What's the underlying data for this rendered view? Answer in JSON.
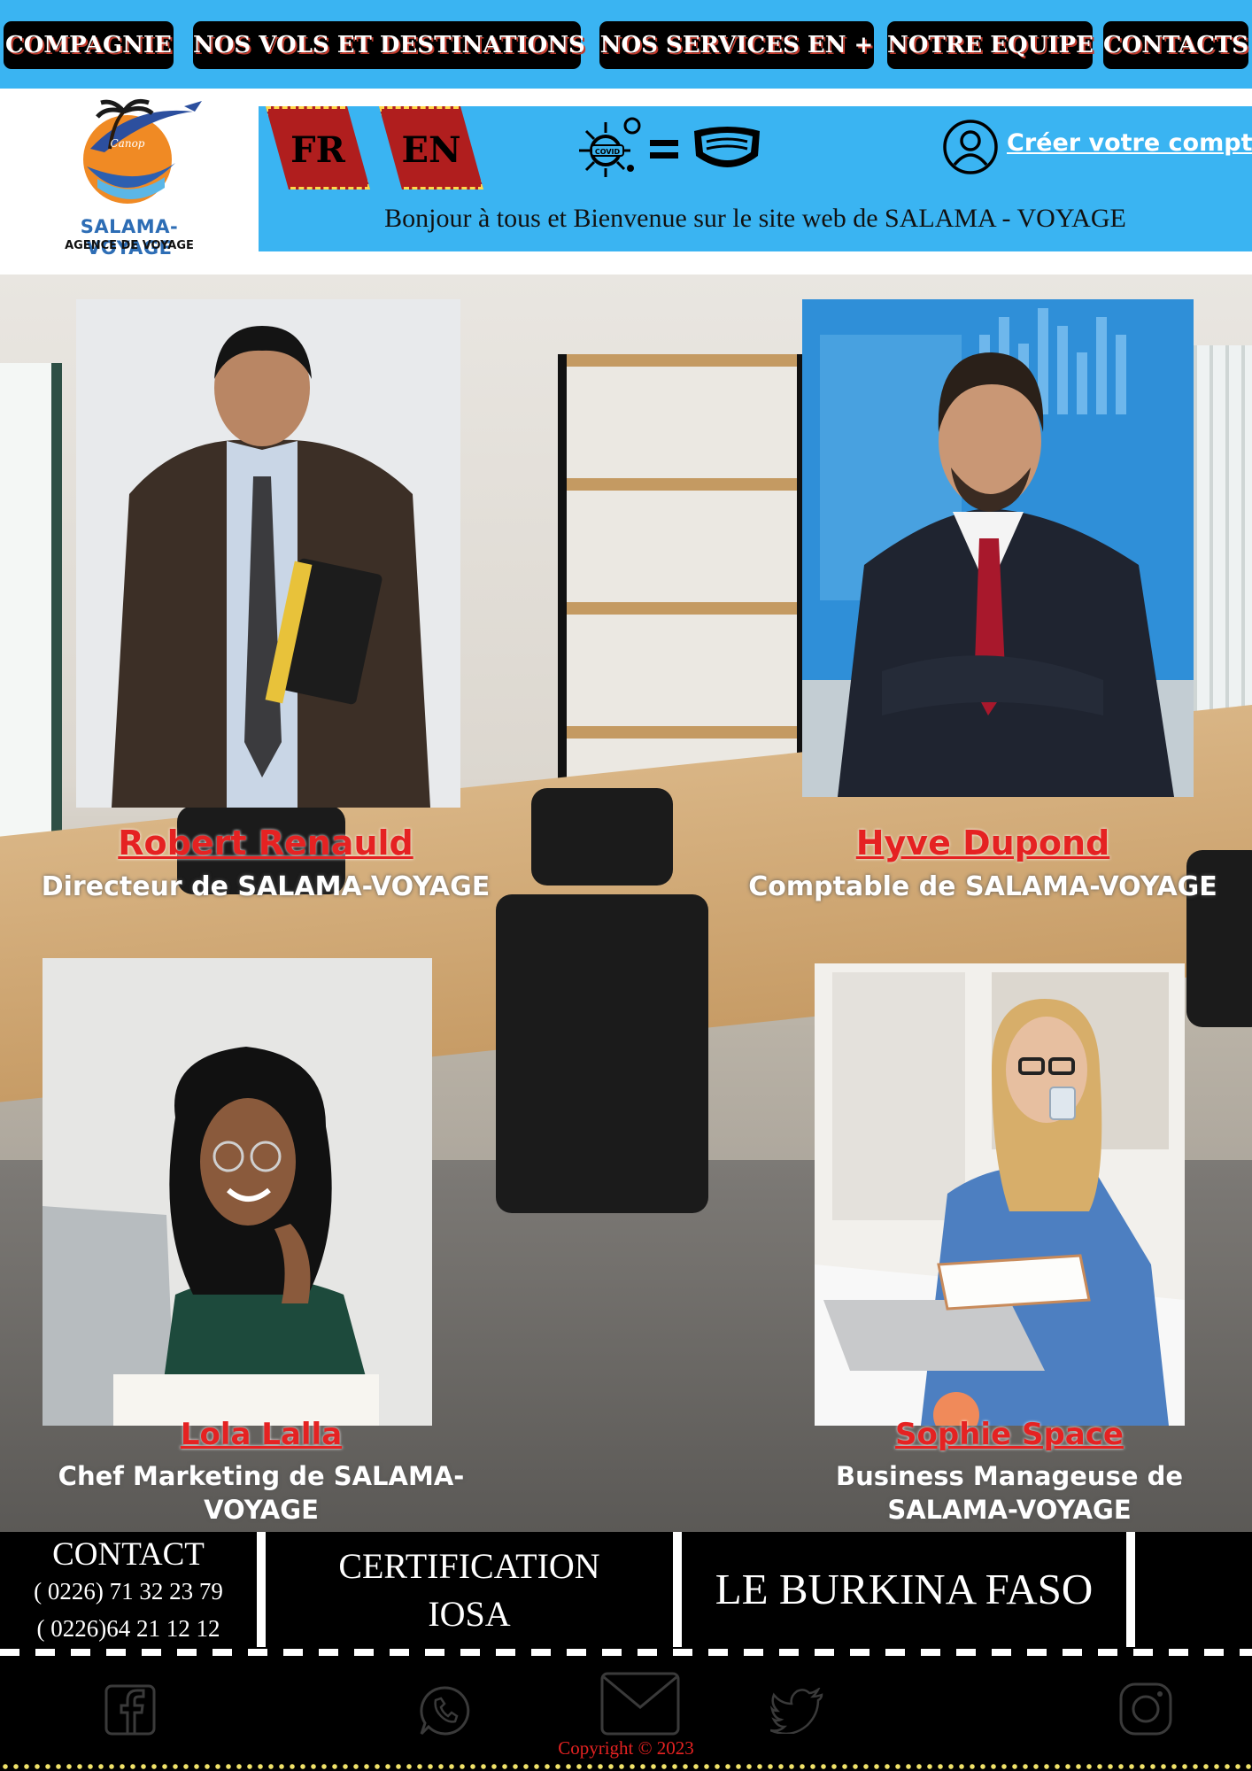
{
  "nav": {
    "items": [
      {
        "label": "COMPAGNIE"
      },
      {
        "label": "NOS VOLS ET DESTINATIONS"
      },
      {
        "label": "NOS SERVICES EN  +"
      },
      {
        "label": "NOTRE EQUIPE"
      },
      {
        "label": "CONTACTS"
      }
    ]
  },
  "header": {
    "logo_name": "SALAMA-VOYAGE",
    "logo_subtitle": "AGENCE DE VOYAGE",
    "logo_badge": "Canop",
    "languages": [
      {
        "label": "FR"
      },
      {
        "label": "EN"
      }
    ],
    "covid_badge": "COVID",
    "account_link": "Créer votre compte",
    "welcome": "Bonjour à tous et Bienvenue sur le site web de SALAMA - VOYAGE"
  },
  "team": {
    "members": [
      {
        "name": "Robert Renauld",
        "role": "Directeur de SALAMA-VOYAGE"
      },
      {
        "name": "Hyve Dupond",
        "role": "Comptable de SALAMA-VOYAGE"
      },
      {
        "name": "Lola Lalla",
        "role": "Chef Marketing de SALAMA-VOYAGE"
      },
      {
        "name": "Sophie Space",
        "role": "Business Manageuse  de SALAMA-VOYAGE"
      }
    ]
  },
  "footer": {
    "contact_title": "CONTACT",
    "phones": [
      "( 0226) 71 32 23 79",
      "( 0226)64 21 12 12"
    ],
    "certification": "CERTIFICATION IOSA",
    "country": "LE BURKINA FASO",
    "copyright": "Copyright © 2023"
  },
  "colors": {
    "accent_blue": "#3ab4f2",
    "brand_red": "#e52222",
    "nav_background": "#000000"
  },
  "icons": [
    "facebook-icon",
    "whatsapp-icon",
    "mail-icon",
    "twitter-icon",
    "instagram-icon",
    "user-icon",
    "covid-virus-icon",
    "mask-icon"
  ]
}
